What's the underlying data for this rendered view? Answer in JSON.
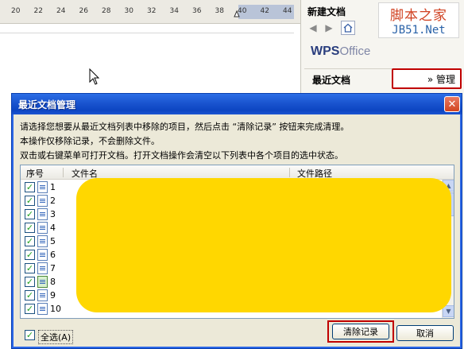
{
  "ruler": {
    "numbers": [
      "20",
      "22",
      "24",
      "26",
      "28",
      "30",
      "32",
      "34",
      "36",
      "38",
      "40",
      "42",
      "44"
    ]
  },
  "pane": {
    "header": "新建文档",
    "site_logo": {
      "line1": "脚本之家",
      "line2": "JB51.Net"
    },
    "wps_logo": {
      "bold": "WPS",
      "rest": "Office"
    },
    "recent_docs_title": "最近文档",
    "manage_link": "» 管理",
    "tools": [
      "back-arrow-icon",
      "forward-arrow-icon",
      "home-icon"
    ]
  },
  "dialog": {
    "title": "最近文档管理",
    "close_label": "✕",
    "desc_line1": "请选择您想要从最近文档列表中移除的项目，然后点击 “清除记录” 按钮来完成清理。",
    "desc_line2": "本操作仅移除记录，不会删除文件。",
    "desc_line3": "双击或右键菜单可打开文档。打开文档操作会清空以下列表中各个项目的选中状态。",
    "columns": {
      "index": "序号",
      "filename": "文件名",
      "filepath": "文件路径"
    },
    "rows": [
      {
        "num": "1",
        "checked": true,
        "icon": "word-doc-icon"
      },
      {
        "num": "2",
        "checked": true,
        "icon": "word-doc-icon"
      },
      {
        "num": "3",
        "checked": true,
        "icon": "word-doc-icon"
      },
      {
        "num": "4",
        "checked": true,
        "icon": "word-doc-icon"
      },
      {
        "num": "5",
        "checked": true,
        "icon": "word-doc-icon"
      },
      {
        "num": "6",
        "checked": true,
        "icon": "word-doc-icon"
      },
      {
        "num": "7",
        "checked": true,
        "icon": "word-doc-icon"
      },
      {
        "num": "8",
        "checked": true,
        "icon": "web-doc-icon"
      },
      {
        "num": "9",
        "checked": true,
        "icon": "word-doc-icon"
      },
      {
        "num": "10",
        "checked": true,
        "icon": "word-doc-icon"
      }
    ],
    "select_all_label": "全选(A)",
    "select_all_checked": true,
    "clear_button": "清除记录",
    "cancel_button": "取消"
  },
  "colors": {
    "titlebar": "#0d45c2",
    "highlight_border": "#c00000",
    "redaction": "#ffd700",
    "check_mark": "#21a121"
  }
}
